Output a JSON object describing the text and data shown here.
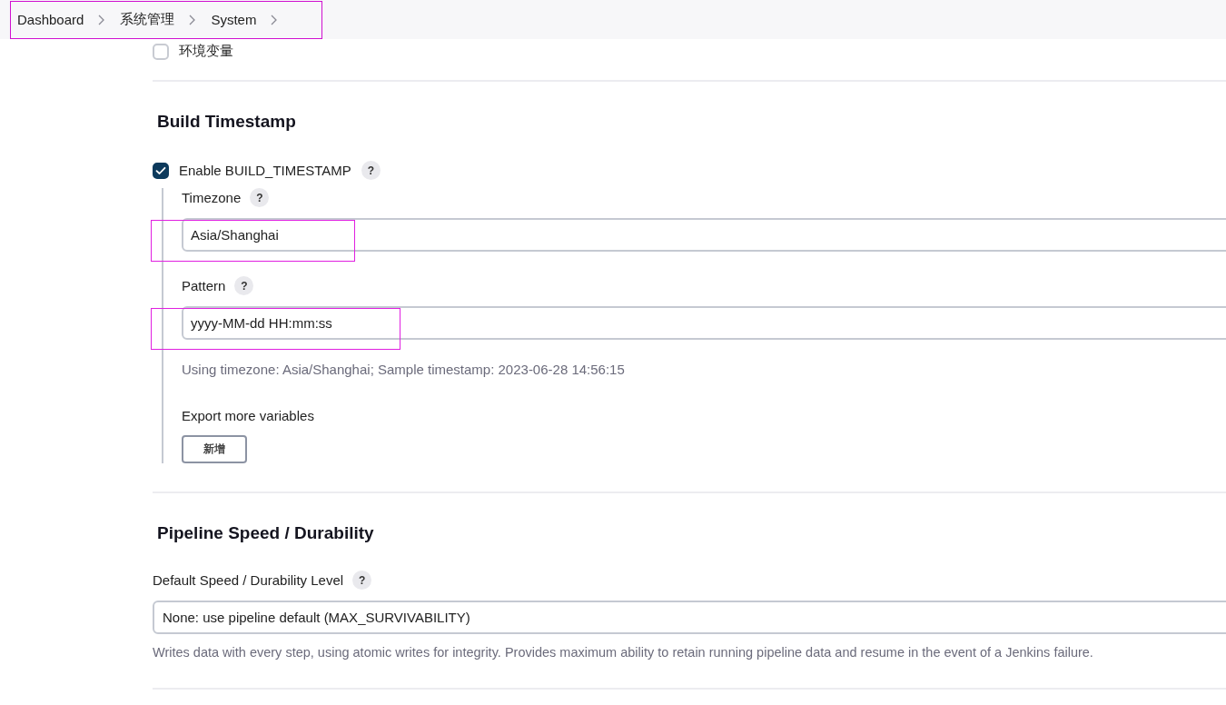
{
  "breadcrumb": {
    "highlighted": true,
    "items": [
      {
        "label": "Dashboard"
      },
      {
        "label": "系统管理"
      },
      {
        "label": "System"
      }
    ]
  },
  "env_vars": {
    "label": "环境变量",
    "checked": false
  },
  "sections": [
    {
      "kind": "timestamp",
      "title": "Build Timestamp",
      "enable": {
        "label": "Enable BUILD_TIMESTAMP",
        "checked": true,
        "help": "?"
      },
      "fields": [
        {
          "label": "Timezone",
          "help": "?",
          "value": "Asia/Shanghai",
          "highlighted": true
        },
        {
          "label": "Pattern",
          "help": "?",
          "value": "yyyy-MM-dd HH:mm:ss",
          "highlighted": true,
          "hint": "Using timezone: Asia/Shanghai; Sample timestamp: 2023-06-28 14:56:15"
        }
      ],
      "export_label": "Export more variables",
      "add_button": "新增"
    },
    {
      "kind": "durability",
      "title": "Pipeline Speed / Durability",
      "field": {
        "label": "Default Speed / Durability Level",
        "help": "?",
        "value": "None: use pipeline default (MAX_SURVIVABILITY)",
        "description": "Writes data with every step, using atomic writes for integrity.  Provides maximum ability to retain running pipeline data and resume in the event of a Jenkins failure."
      }
    }
  ]
}
